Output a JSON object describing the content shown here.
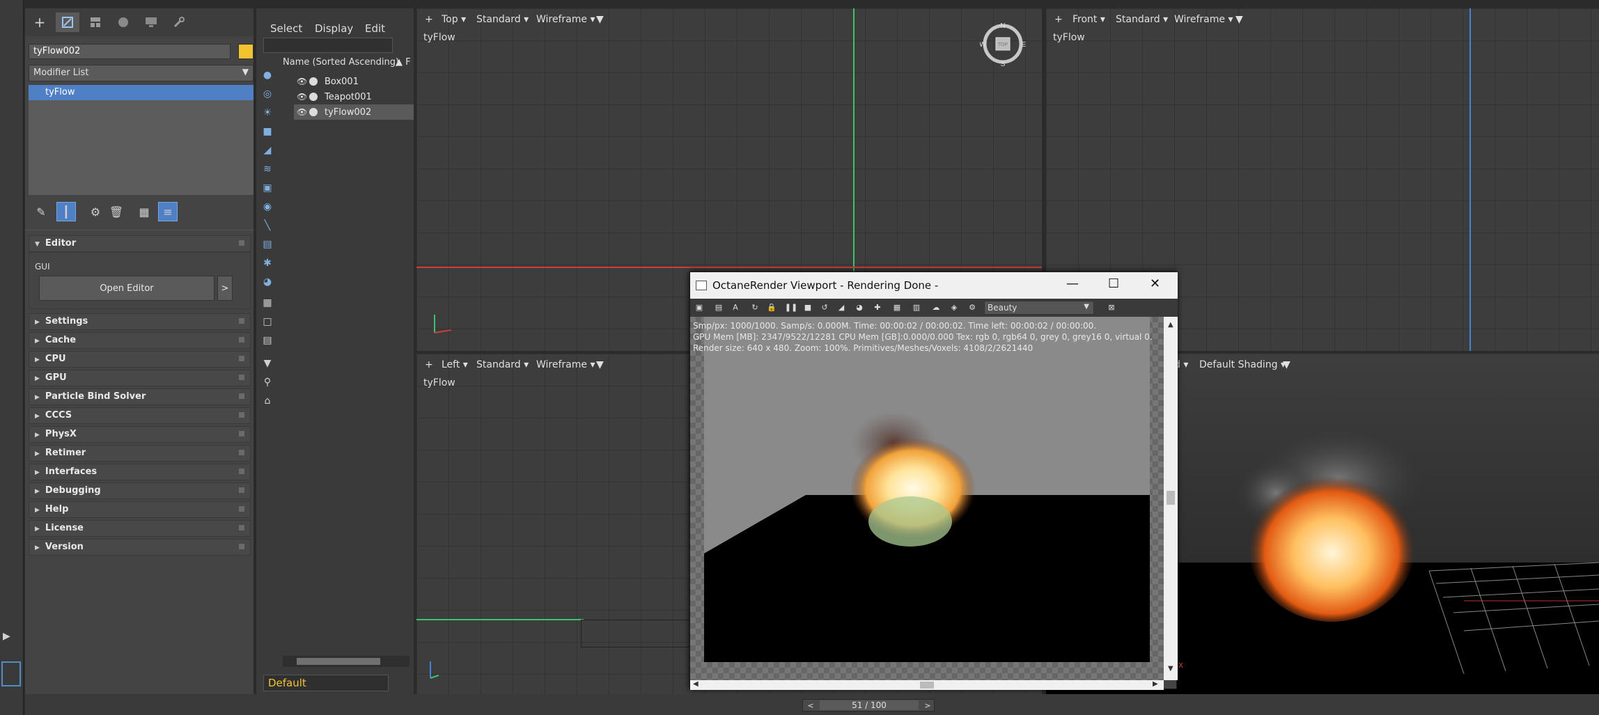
{
  "command_panel": {
    "object_name": "tyFlow002",
    "object_color": "#f4c430",
    "modifier_list_label": "Modifier List",
    "modifier_stack": [
      "tyFlow"
    ],
    "editor": {
      "title": "Editor",
      "gui_label": "GUI",
      "open_editor_label": "Open Editor",
      "open_editor_arrow": ">"
    },
    "rollouts": [
      "Settings",
      "Cache",
      "CPU",
      "GPU",
      "Particle Bind Solver",
      "CCCS",
      "PhysX",
      "Retimer",
      "Interfaces",
      "Debugging",
      "Help",
      "License",
      "Version"
    ]
  },
  "scene_explorer": {
    "menu": [
      "Select",
      "Display",
      "Edit"
    ],
    "column_header": "Name (Sorted Ascending)",
    "sort_indicator": "▲ F",
    "rows": [
      {
        "name": "Box001",
        "selected": false
      },
      {
        "name": "Teapot001",
        "selected": false
      },
      {
        "name": "tyFlow002",
        "selected": true
      }
    ],
    "layer": "Default"
  },
  "viewports": {
    "top": {
      "plus": "+",
      "view": "Top ▾",
      "shading": "Standard ▾",
      "mode": "Wireframe ▾",
      "label": "tyFlow"
    },
    "front": {
      "plus": "+",
      "view": "Front ▾",
      "shading": "Standard ▾",
      "mode": "Wireframe ▾",
      "label": "tyFlow"
    },
    "left": {
      "plus": "+",
      "view": "Left ▾",
      "shading": "Standard ▾",
      "mode": "Wireframe ▾",
      "label": "tyFlow"
    },
    "persp": {
      "view": "d ▾",
      "mode": "Default Shading ▾"
    }
  },
  "octane": {
    "title": "OctaneRender Viewport - Rendering Done -",
    "pass": "Beauty",
    "stats": [
      "Smp/px: 1000/1000.  Samp/s: 0.000M.  Time: 00:00:02 / 00:00:02.  Time left: 00:00:02 / 00:00:00.",
      "GPU Mem [MB]: 2347/9522/12281  CPU Mem [GB]:0.000/0.000  Tex: rgb 0, rgb64 0, grey 0, grey16 0, virtual 0.",
      "Render size: 640 x 480.  Zoom: 100%.  Primitives/Meshes/Voxels: 4108/2/2621440"
    ]
  },
  "timeline": {
    "frame": "51 / 100",
    "prev": "<",
    "next": ">"
  },
  "compass": {
    "n": "N",
    "s": "S",
    "e": "E",
    "w": "W",
    "cube": "TOP"
  },
  "axis": {
    "x": "x",
    "y": "y"
  },
  "colors": {
    "accent": "#4f7fc4",
    "selection_yellow": "#f4c430"
  }
}
